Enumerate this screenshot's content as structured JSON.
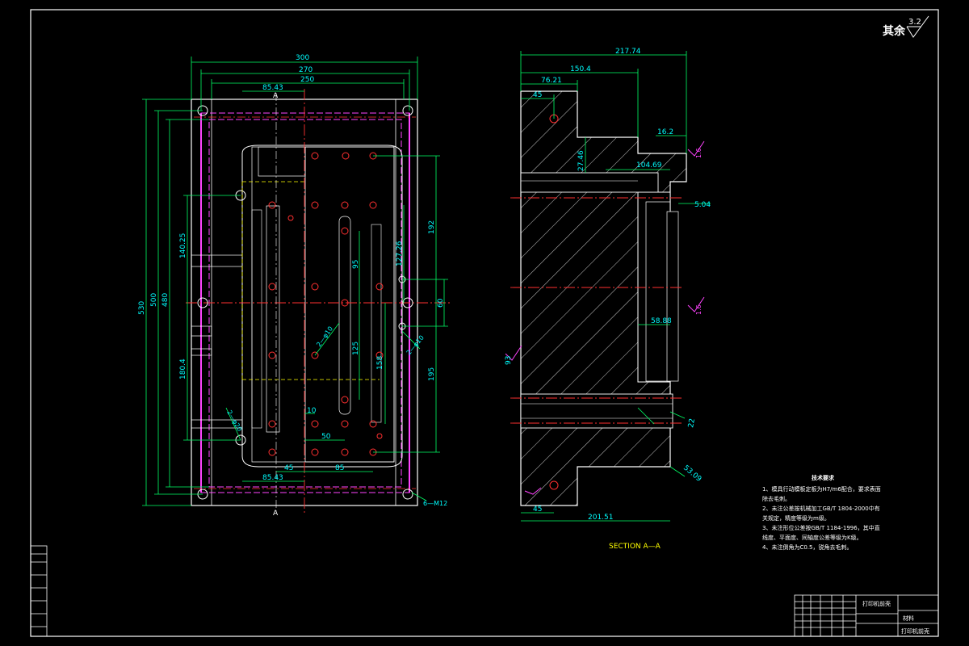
{
  "title_block": {
    "roughness_label": "其余",
    "roughness_value": "3.2",
    "part_name": "打印机前壳",
    "material_label": "材料",
    "drawing_label": "打印机前壳"
  },
  "section_label": "SECTION A—A",
  "tech_notes": {
    "title": "技术要求",
    "items": [
      "1、模具行动模板定板为H7/m6配合，要求表面除去毛刺。",
      "2、未注公差按机械加工GB/T 1804-2000中有关规定，精度等级为m级。",
      "3、未注形位公差按GB/T 1184-1996，其中直线度、平面度、同轴度公差等级为K级。",
      "4、未注倒角为C0.5，锐角去毛刺。"
    ]
  },
  "plan_view": {
    "dims": {
      "d300": "300",
      "d270": "270",
      "d250": "250",
      "d8543_top": "85.43",
      "d530": "530",
      "d500": "500",
      "d480": "480",
      "d14025": "140.25",
      "d1804": "180.4",
      "d192": "192",
      "d12726": "127.26",
      "d95": "95",
      "d60": "60",
      "d125": "125",
      "d158": "158",
      "d195": "195",
      "d10": "10",
      "d50": "50",
      "d45": "45",
      "d85": "85",
      "d8543_bot": "85.43",
      "d2phi10": "2—φ10",
      "d2phi10b": "2—φ10",
      "d2phi20": "2—φ20",
      "d6m12": "6—M12",
      "sectionA_top": "A",
      "sectionA_bot": "A"
    }
  },
  "section_view": {
    "dims": {
      "d21774": "217.74",
      "d1504": "150.4",
      "d7621": "76.21",
      "d45_top": "45",
      "d162": "16.2",
      "d2746": "27.46",
      "d1046": "104.69",
      "d504": "5.04",
      "d5888": "58.88",
      "d22": "22",
      "d20151": "201.51",
      "d45_bot": "45",
      "d93": "93",
      "d5309": "53.09",
      "r16a": "1.6",
      "r16b": "1.6",
      "r32a": "3.2"
    }
  },
  "colors": {
    "outline": "#ffffff",
    "dimension": "#00ff66",
    "centerline": "#ff3030",
    "hidden": "#ff44ff",
    "text": "#00ffff",
    "hatch": "#ffffff",
    "dashed_yellow": "#ffff00"
  }
}
